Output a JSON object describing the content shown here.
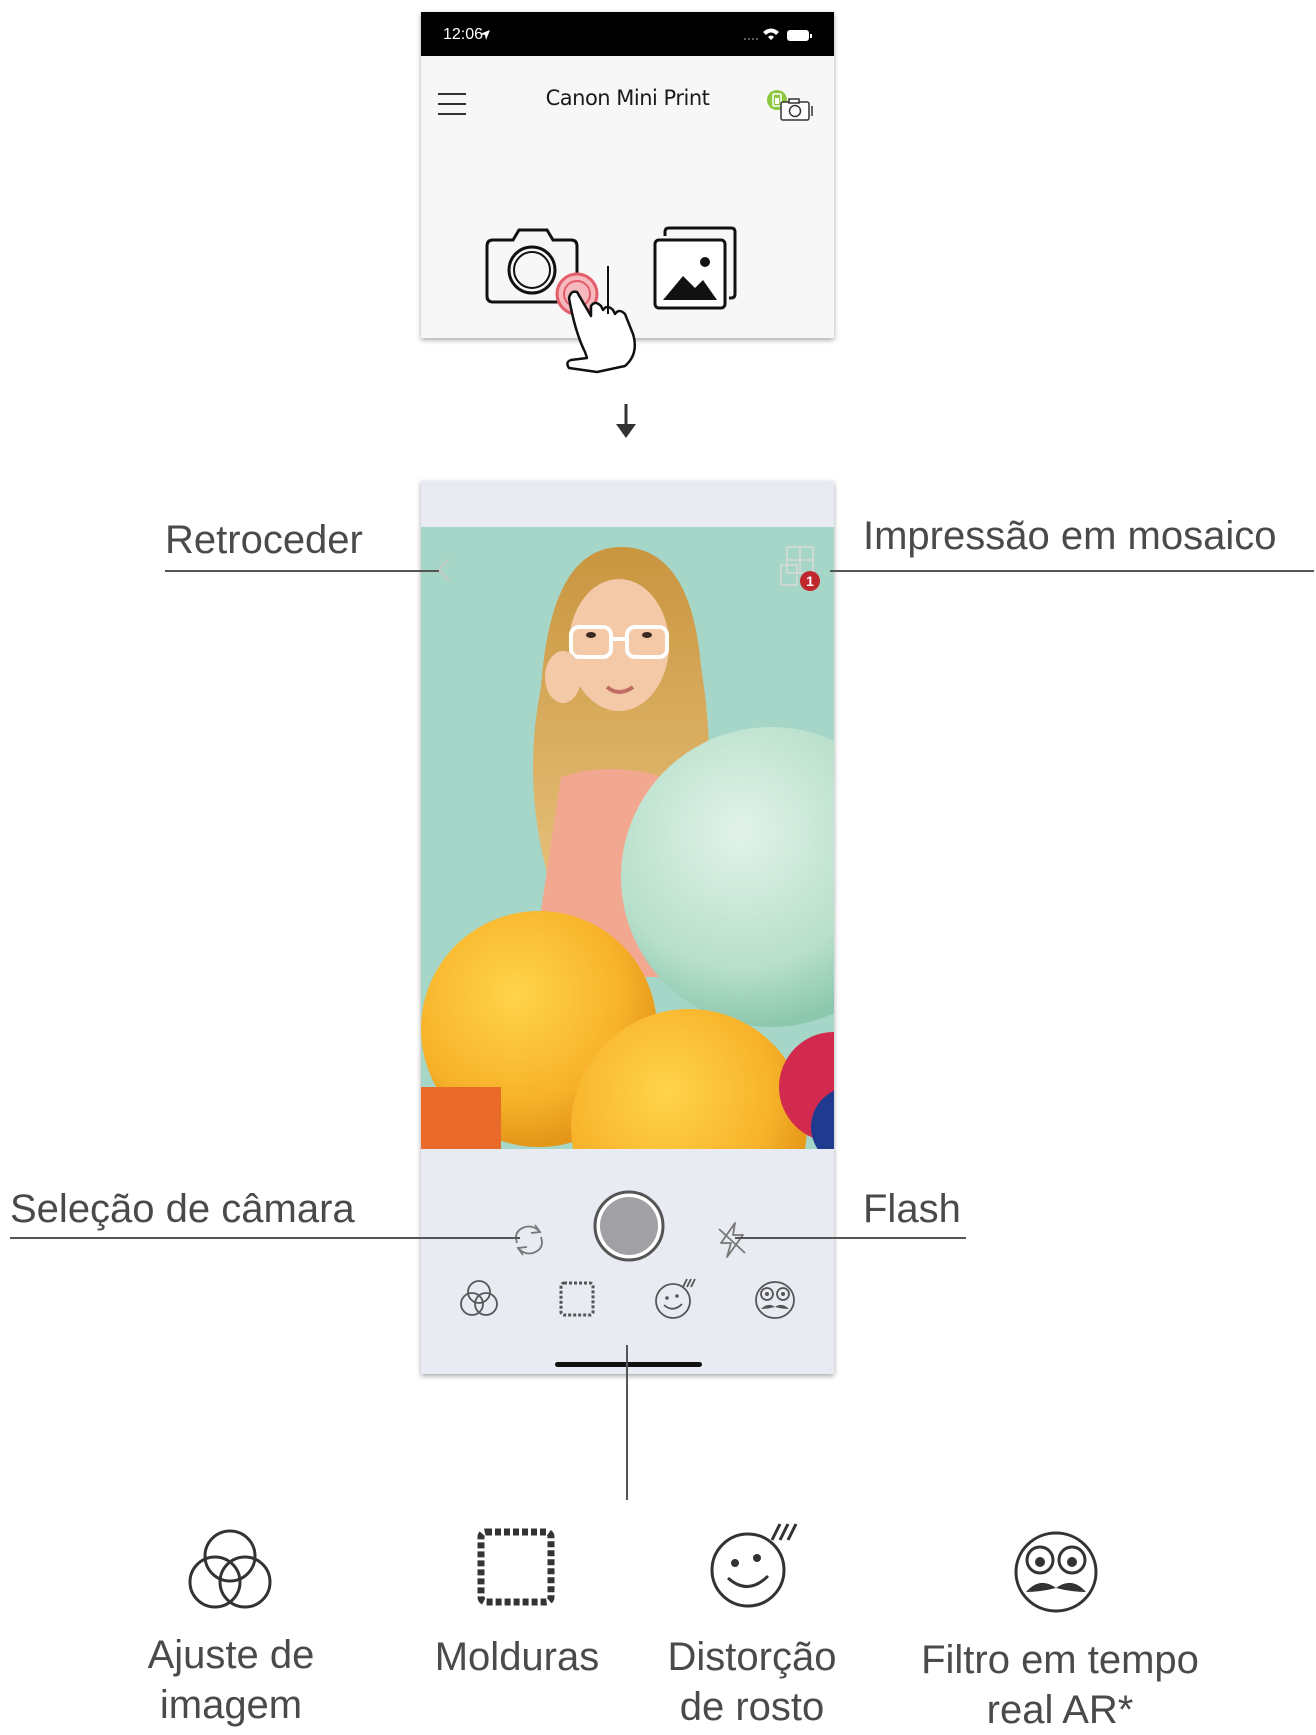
{
  "top_screen": {
    "status_time": "12:06",
    "app_title": "Canon Mini Print"
  },
  "callouts": {
    "back": "Retroceder",
    "tile_print": "Impressão em mosaico",
    "camera_select": "Seleção de câmara",
    "flash": "Flash"
  },
  "tile_badge_count": "1",
  "features": [
    {
      "label_line1": "Ajuste de",
      "label_line2": "imagem",
      "icon": "venn-circles-icon"
    },
    {
      "label_line1": "Molduras",
      "label_line2": "",
      "icon": "frame-icon"
    },
    {
      "label_line1": "Distorção",
      "label_line2": "de rosto",
      "icon": "face-distortion-icon"
    },
    {
      "label_line1": "Filtro em tempo",
      "label_line2": "real AR*",
      "icon": "ar-mask-icon"
    }
  ]
}
